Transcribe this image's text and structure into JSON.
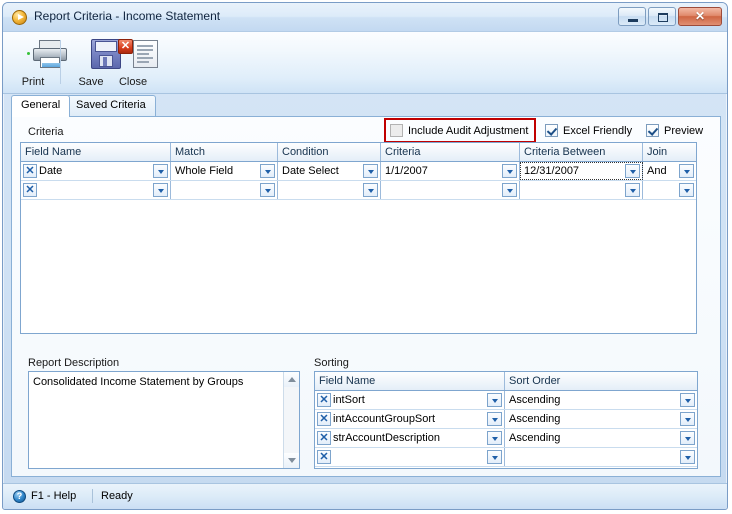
{
  "window": {
    "title": "Report Criteria - Income Statement",
    "title_icon": "play-circle-icon",
    "buttons": {
      "minimize": "minimize-icon",
      "maximize": "maximize-icon",
      "close": "✕"
    }
  },
  "toolbar": {
    "items": [
      {
        "label": "Print",
        "icon": "printer-icon"
      },
      {
        "label": "Save",
        "icon": "floppy-disk-icon"
      },
      {
        "label": "Close",
        "icon": "document-close-icon"
      }
    ]
  },
  "tabs": [
    {
      "label": "General",
      "active": true
    },
    {
      "label": "Saved Criteria",
      "active": false
    }
  ],
  "options": {
    "include_audit_adjustment": {
      "label": "Include Audit Adjustment",
      "checked": false,
      "highlighted": true
    },
    "excel_friendly": {
      "label": "Excel Friendly",
      "checked": true
    },
    "preview": {
      "label": "Preview",
      "checked": true
    }
  },
  "criteria": {
    "section_label": "Criteria",
    "columns": [
      "Field Name",
      "Match",
      "Condition",
      "Criteria",
      "Criteria Between",
      "Join"
    ],
    "rows": [
      {
        "field_name": "Date",
        "match": "Whole Field",
        "condition": "Date Select",
        "criteria": "1/1/2007",
        "criteria_between": "12/31/2007",
        "join": "And"
      },
      {
        "field_name": "",
        "match": "",
        "condition": "",
        "criteria": "",
        "criteria_between": "",
        "join": ""
      }
    ]
  },
  "report_description": {
    "label": "Report Description",
    "text": "Consolidated Income Statement by Groups"
  },
  "sorting": {
    "section_label": "Sorting",
    "columns": [
      "Field Name",
      "Sort Order"
    ],
    "rows": [
      {
        "field_name": "intSort",
        "sort_order": "Ascending"
      },
      {
        "field_name": "intAccountGroupSort",
        "sort_order": "Ascending"
      },
      {
        "field_name": "strAccountDescription",
        "sort_order": "Ascending"
      },
      {
        "field_name": "",
        "sort_order": ""
      }
    ]
  },
  "statusbar": {
    "help_label": "F1 - Help",
    "status": "Ready",
    "help_icon": "?"
  },
  "colors": {
    "highlight": "#c00000",
    "accent": "#1f5fa8",
    "frame": "#7a9cc6"
  }
}
